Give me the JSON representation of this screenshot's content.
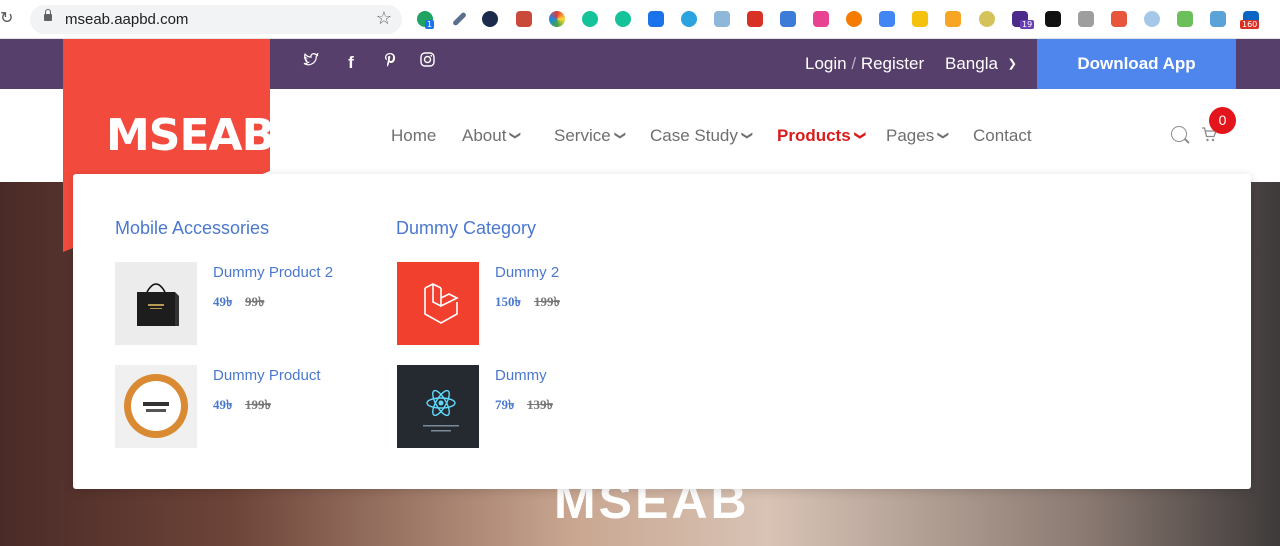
{
  "browser": {
    "url": "mseab.aapbd.com",
    "extension_badges": [
      "1",
      "19",
      "160"
    ]
  },
  "topbar": {
    "social": [
      "twitter-icon",
      "facebook-icon",
      "pinterest-icon",
      "instagram-icon"
    ],
    "login": "Login",
    "separator": "/",
    "register": "Register",
    "language": "Bangla",
    "download": "Download App"
  },
  "brand": {
    "logo": "MSEAB"
  },
  "nav": {
    "items": [
      {
        "label": "Home",
        "dropdown": false
      },
      {
        "label": "About",
        "dropdown": true
      },
      {
        "label": "Service",
        "dropdown": true
      },
      {
        "label": "Case Study",
        "dropdown": true
      },
      {
        "label": "Products",
        "dropdown": true,
        "active": true
      },
      {
        "label": "Pages",
        "dropdown": true
      },
      {
        "label": "Contact",
        "dropdown": false
      }
    ],
    "cart_count": "0"
  },
  "mega_menu": {
    "categories": [
      {
        "title": "Mobile Accessories",
        "products": [
          {
            "name": "Dummy Product 2",
            "price": "49৳",
            "old_price": "99৳"
          },
          {
            "name": "Dummy Product",
            "price": "49৳",
            "old_price": "199৳"
          }
        ]
      },
      {
        "title": "Dummy Category",
        "products": [
          {
            "name": "Dummy 2",
            "price": "150৳",
            "old_price": "199৳"
          },
          {
            "name": "Dummy",
            "price": "79৳",
            "old_price": "139৳"
          }
        ]
      }
    ]
  },
  "hero": {
    "title": "MSEAB"
  },
  "colors": {
    "topbar": "#573f6b",
    "download": "#4e86ee",
    "logo_bg": "#f24b3d",
    "accent_link": "#4b78cf",
    "active_nav": "#d91d1d"
  }
}
